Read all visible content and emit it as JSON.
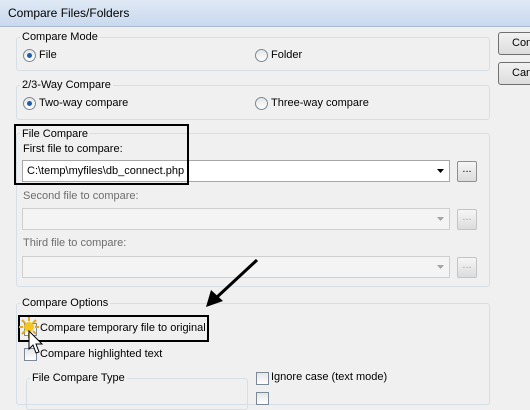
{
  "window": {
    "title": "Compare Files/Folders"
  },
  "side_buttons": {
    "compare_label": "Compare",
    "cancel_label": "Cancel"
  },
  "compare_mode": {
    "label": "Compare Mode",
    "options": [
      {
        "label": "File",
        "selected": true
      },
      {
        "label": "Folder",
        "selected": false
      }
    ]
  },
  "way_compare": {
    "label": "2/3-Way Compare",
    "options": [
      {
        "label": "Two-way compare",
        "selected": true
      },
      {
        "label": "Three-way compare",
        "selected": false
      }
    ]
  },
  "file_compare": {
    "label": "File Compare",
    "first_label": "First file to compare:",
    "first_value": "C:\\temp\\myfiles\\db_connect.php",
    "second_label": "Second file to compare:",
    "second_value": "",
    "third_label": "Third file to compare:",
    "third_value": "",
    "browse_label": "..."
  },
  "compare_options": {
    "label": "Compare Options",
    "temp_file_label": "Compare temporary file to original",
    "highlighted_label": "Compare highlighted text",
    "file_compare_type_label": "File Compare Type",
    "ignore_case_label": "Ignore case (text mode)"
  },
  "colors": {
    "accent": "#1f5fa8",
    "highlight_border": "#000000",
    "cursor_glow": "#f3c623"
  }
}
